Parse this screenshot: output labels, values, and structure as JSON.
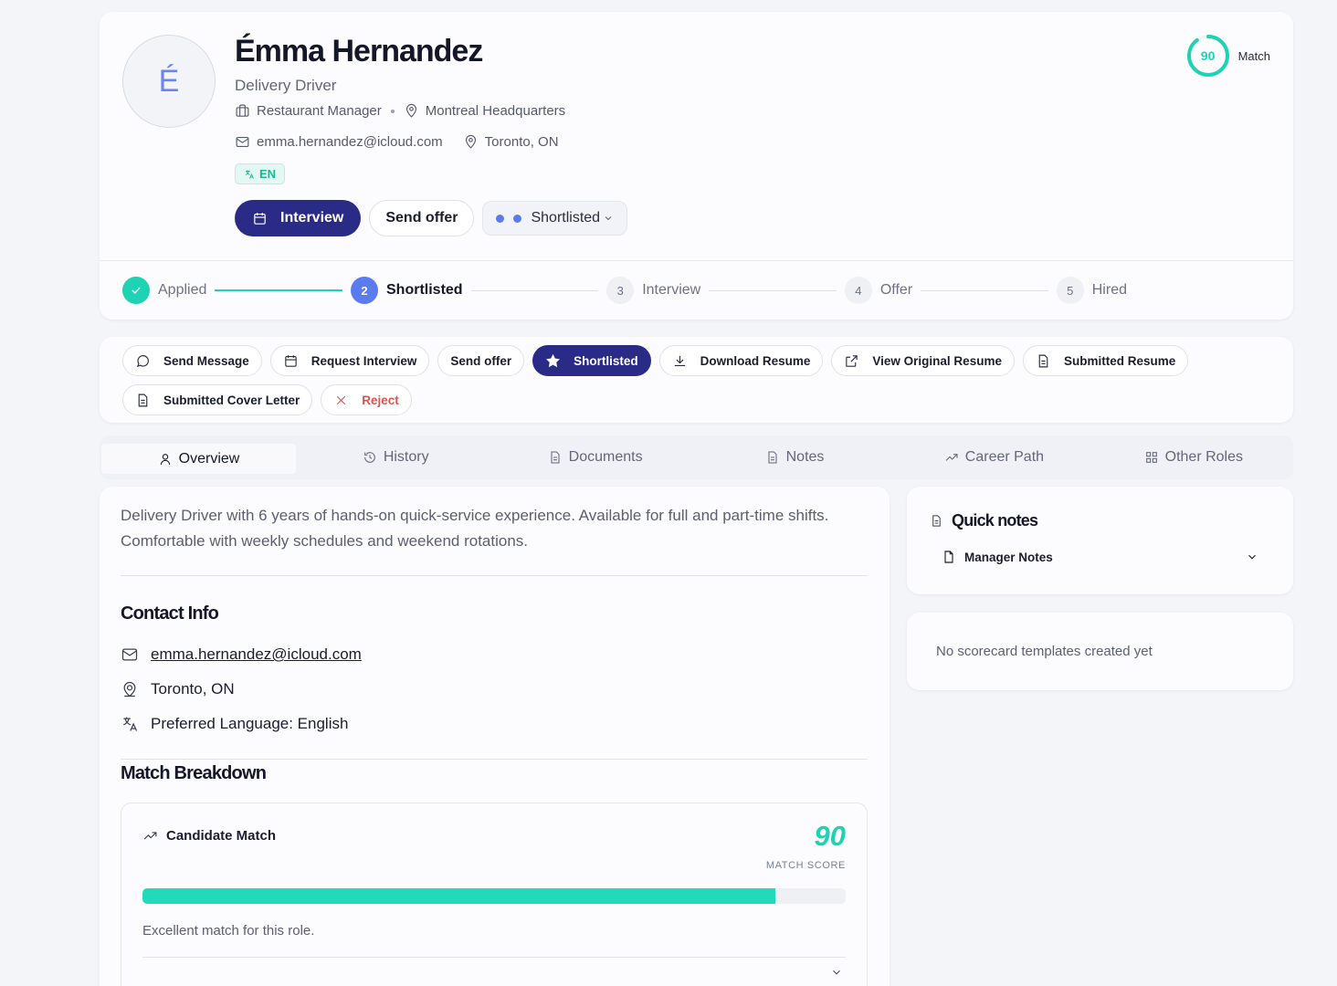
{
  "candidate": {
    "initial": "É",
    "name": "Émma Hernandez",
    "role": "Delivery Driver",
    "position": "Restaurant Manager",
    "office": "Montreal Headquarters",
    "email": "emma.hernandez@icloud.com",
    "location": "Toronto, ON",
    "language_badge": "EN"
  },
  "match": {
    "score": "90",
    "label": "Match",
    "fraction": 0.9
  },
  "header_buttons": {
    "interview": "Interview",
    "send_offer": "Send offer",
    "status": "Shortlisted"
  },
  "stepper": [
    {
      "num": "1",
      "label": "Applied",
      "state": "done"
    },
    {
      "num": "2",
      "label": "Shortlisted",
      "state": "current"
    },
    {
      "num": "3",
      "label": "Interview",
      "state": "todo"
    },
    {
      "num": "4",
      "label": "Offer",
      "state": "todo"
    },
    {
      "num": "5",
      "label": "Hired",
      "state": "todo"
    }
  ],
  "actions": {
    "send_message": "Send Message",
    "request_interview": "Request Interview",
    "send_offer": "Send offer",
    "shortlisted": "Shortlisted",
    "download_resume": "Download Resume",
    "view_original_resume": "View Original Resume",
    "submitted_resume": "Submitted Resume",
    "submitted_cover_letter": "Submitted Cover Letter",
    "reject": "Reject"
  },
  "tabs": {
    "overview": "Overview",
    "history": "History",
    "documents": "Documents",
    "notes": "Notes",
    "career_path": "Career Path",
    "other_roles": "Other Roles"
  },
  "overview": {
    "summary": "Delivery Driver with 6 years of hands-on quick-service experience. Available for full and part-time shifts. Comfortable with weekly schedules and weekend rotations.",
    "contact_title": "Contact Info",
    "contact_email": "emma.hernandez@icloud.com",
    "contact_location": "Toronto, ON",
    "contact_language": "Preferred Language: English",
    "breakdown_title": "Match Breakdown",
    "candidate_match_label": "Candidate Match",
    "candidate_match_score": "90",
    "match_score_caption": "MATCH SCORE",
    "match_progress": 0.9,
    "match_comment": "Excellent match for this role."
  },
  "quicknotes": {
    "title": "Quick notes",
    "item": "Manager Notes"
  },
  "scorecard": {
    "empty_text": "No scorecard templates created yet"
  },
  "colors": {
    "accent": "#2a2b86",
    "teal": "#1ed3b3",
    "blue": "#5b7cf0",
    "danger": "#e0524f"
  }
}
